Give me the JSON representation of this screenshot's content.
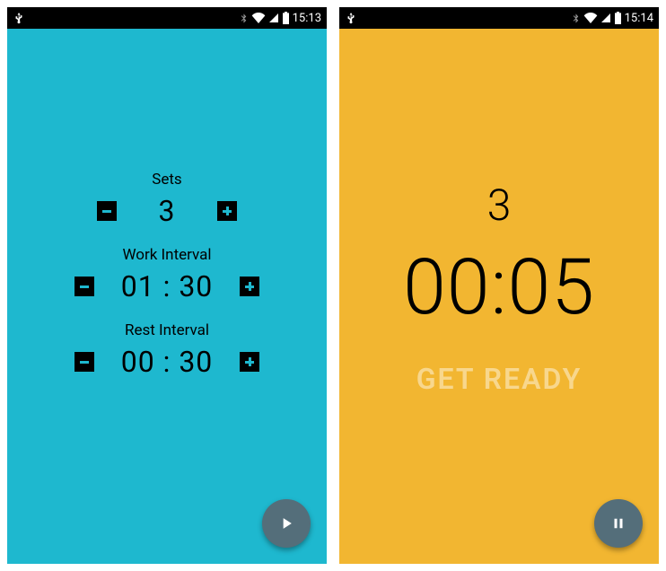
{
  "left": {
    "status": {
      "time": "15:13"
    },
    "sets": {
      "label": "Sets",
      "value": "3"
    },
    "work": {
      "label": "Work Interval",
      "value": "01 : 30"
    },
    "rest": {
      "label": "Rest Interval",
      "value": "00 : 30"
    }
  },
  "right": {
    "status": {
      "time": "15:14"
    },
    "set_number": "3",
    "timer": "00:05",
    "phase": "GET READY"
  }
}
